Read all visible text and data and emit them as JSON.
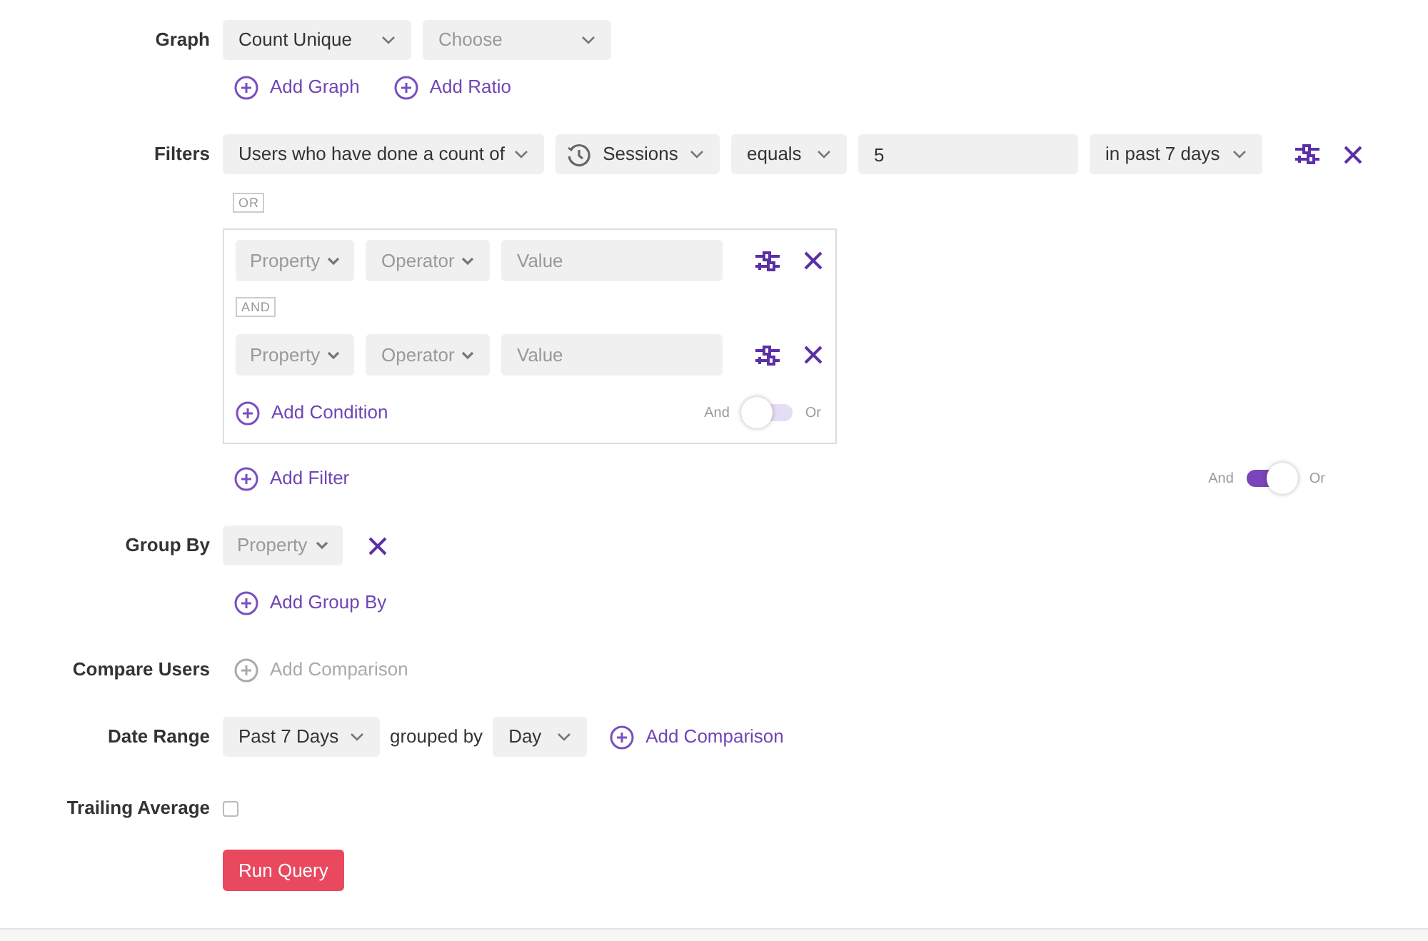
{
  "graph": {
    "label": "Graph",
    "selects": [
      {
        "text": "Count Unique",
        "kind": "value"
      },
      {
        "text": "Choose",
        "kind": "placeholder"
      }
    ],
    "actions": [
      "Add Graph",
      "Add Ratio"
    ]
  },
  "filters": {
    "label": "Filters",
    "fields": [
      {
        "kind": "select",
        "text": "Users who have done a count of"
      },
      {
        "kind": "event-select",
        "text": "Sessions"
      },
      {
        "kind": "select",
        "text": "equals"
      },
      {
        "kind": "input",
        "value": "5"
      },
      {
        "kind": "select",
        "text": "in past 7 days"
      }
    ],
    "or_badge": "OR",
    "group": {
      "conditions": [
        {
          "property": "Property",
          "operator": "Operator",
          "value_placeholder": "Value"
        },
        {
          "property": "Property",
          "operator": "Operator",
          "value_placeholder": "Value"
        }
      ],
      "and_badge": "AND",
      "add_condition": "Add Condition",
      "toggle": {
        "left": "And",
        "right": "Or",
        "on": false
      }
    },
    "add_filter": "Add Filter",
    "toggle": {
      "left": "And",
      "right": "Or",
      "on": true
    }
  },
  "group_by": {
    "label": "Group By",
    "property": "Property",
    "action": "Add Group By"
  },
  "compare_users": {
    "label": "Compare Users",
    "action": "Add Comparison",
    "disabled": true
  },
  "date_range": {
    "label": "Date Range",
    "range": "Past 7 Days",
    "grouped_by": "grouped by",
    "interval": "Day",
    "action": "Add Comparison"
  },
  "trailing_average": {
    "label": "Trailing Average",
    "checked": false
  },
  "run_query": "Run Query"
}
